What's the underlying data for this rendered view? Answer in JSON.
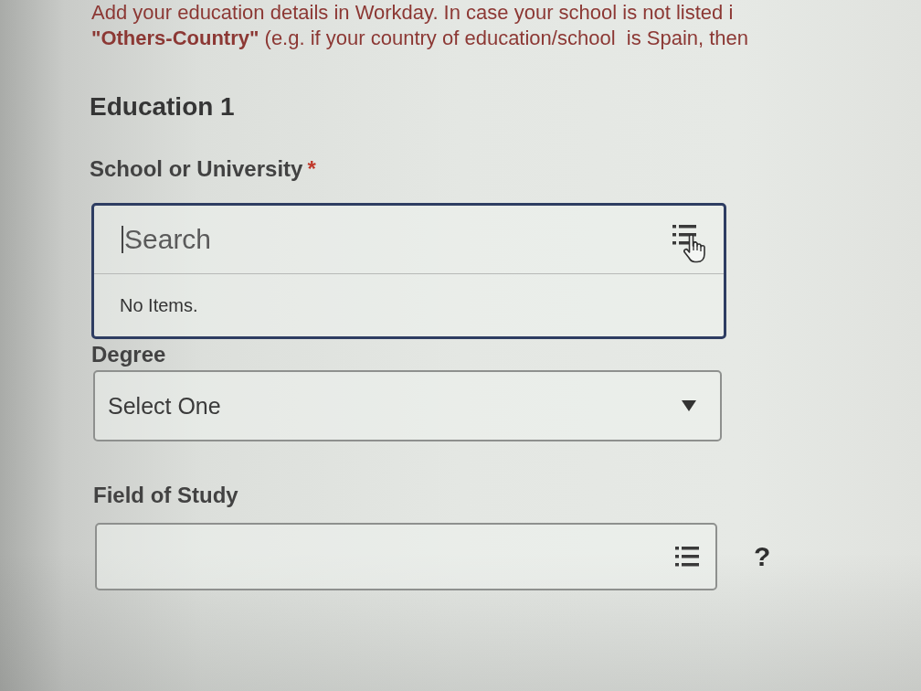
{
  "notice": {
    "lines": [
      "Add your education details in Workday. In case your school is not listed i",
      "**\"Others-Country\"** (e.g. if your country of education/school  is Spain, then"
    ]
  },
  "section": {
    "title": "Education 1"
  },
  "fields": [
    {
      "kind": "combobox",
      "label": "School or University",
      "required_mark": "*",
      "focused": true,
      "expanded": true,
      "placeholder": "Search",
      "message": "No Items."
    },
    {
      "kind": "select",
      "label": "Degree",
      "value": "Select One"
    },
    {
      "kind": "lookup",
      "label": "Field of Study",
      "help": "?"
    }
  ]
}
